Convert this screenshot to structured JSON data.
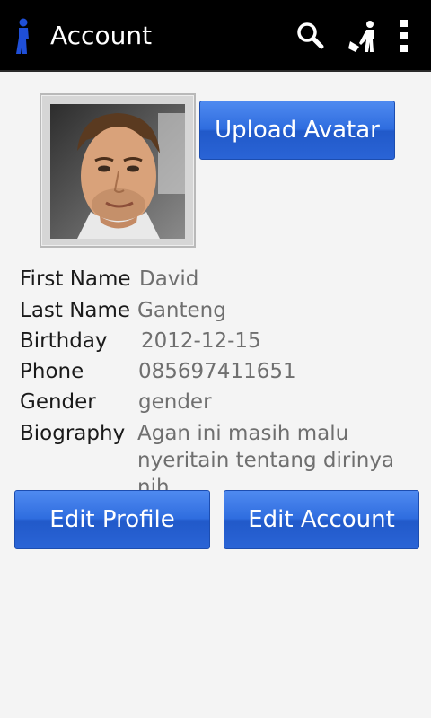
{
  "header": {
    "title": "Account",
    "icons": [
      "app-figure-icon",
      "search-icon",
      "person-cart-icon",
      "overflow-menu-icon"
    ]
  },
  "profile": {
    "upload_label": "Upload Avatar",
    "fields": [
      {
        "label": "First Name",
        "value": "David"
      },
      {
        "label": "Last Name",
        "value": "Ganteng"
      },
      {
        "label": "Birthday",
        "value": "2012-12-15"
      },
      {
        "label": "Phone",
        "value": "085697411651"
      },
      {
        "label": "Gender",
        "value": "gender"
      },
      {
        "label": "Biography",
        "value": "Agan ini masih malu nyeritain tentang dirinya nih"
      }
    ]
  },
  "actions": {
    "edit_profile_label": "Edit Profile",
    "edit_account_label": "Edit Account"
  },
  "colors": {
    "button_blue": "#2f6ddf",
    "action_bar": "#000000",
    "app_icon_blue": "#1f4fd8"
  }
}
